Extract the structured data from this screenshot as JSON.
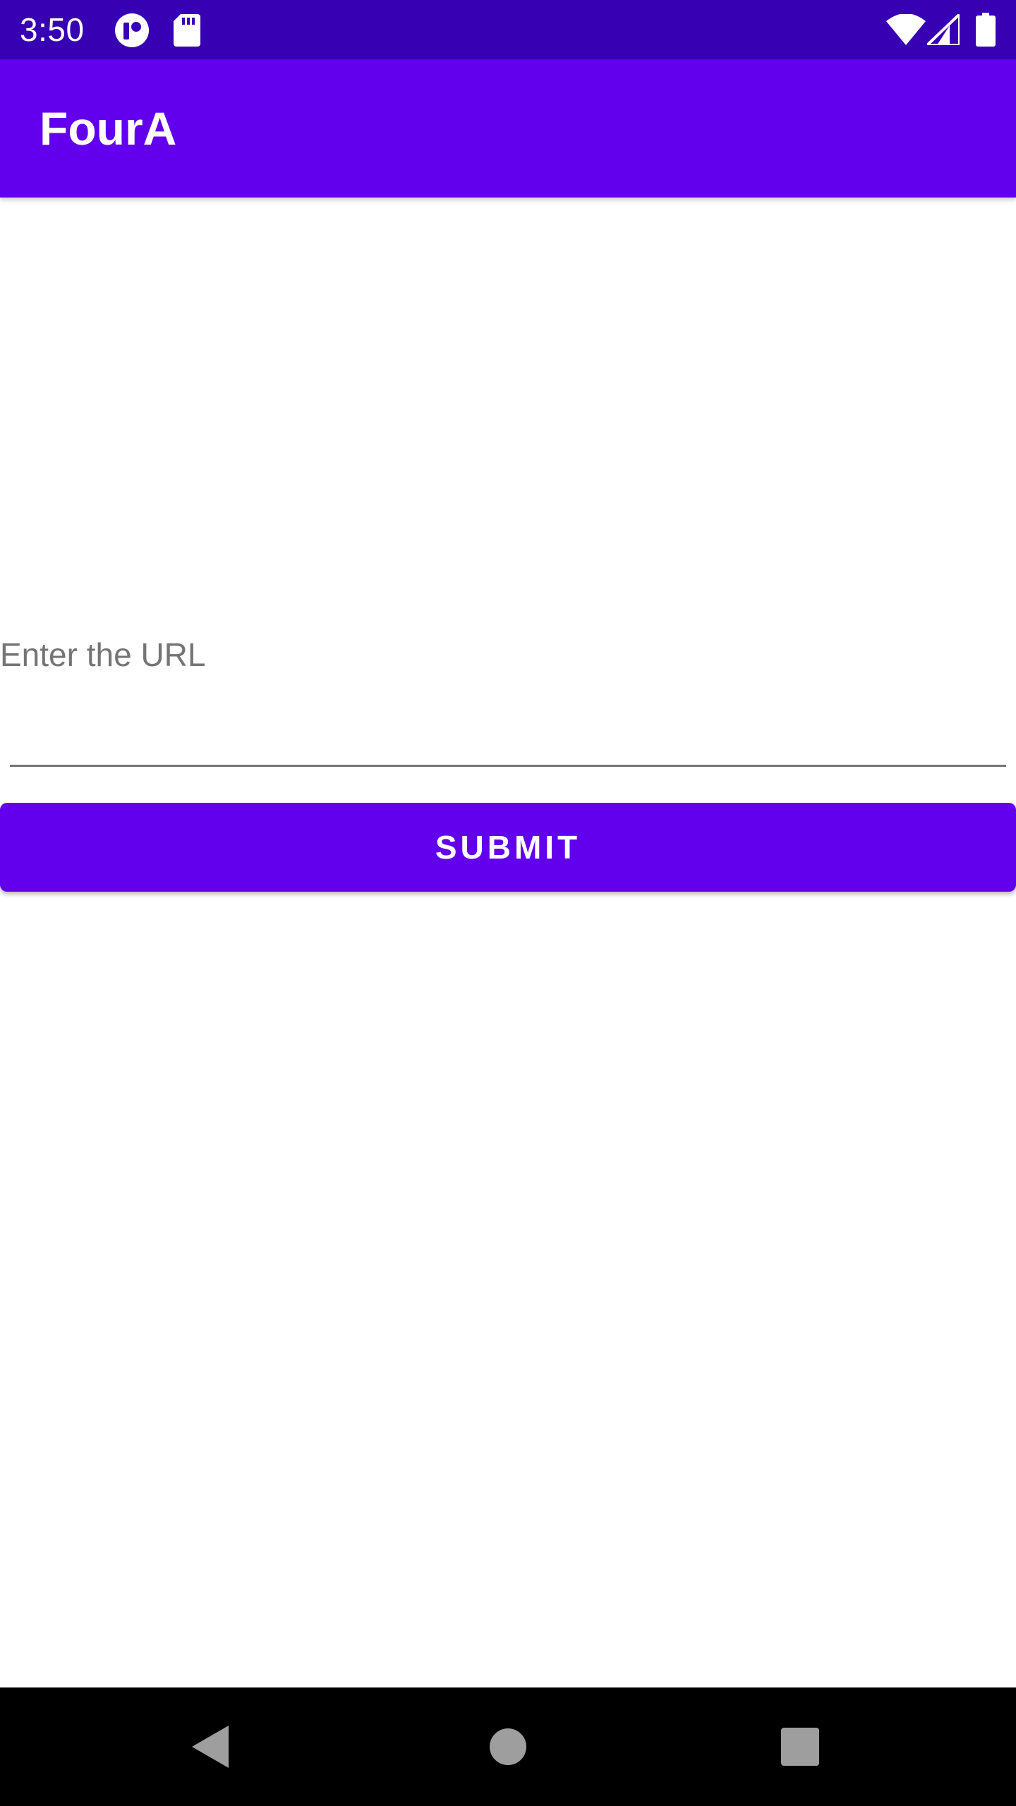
{
  "status_bar": {
    "time": "3:50",
    "icons_left": [
      "app-notification-icon",
      "sd-card-icon"
    ],
    "icons_right": [
      "wifi-icon",
      "cell-signal-icon",
      "battery-icon"
    ],
    "background": "#3700b3"
  },
  "app_bar": {
    "title": "FourA",
    "background": "#6200ee"
  },
  "url_field": {
    "value": "",
    "placeholder": "Enter the URL",
    "placeholder_color": "#757575"
  },
  "submit": {
    "label": "SUBMIT",
    "background": "#6200ee"
  },
  "nav_bar": {
    "buttons": [
      "back-icon",
      "home-icon",
      "recents-icon"
    ],
    "background": "#000000"
  }
}
